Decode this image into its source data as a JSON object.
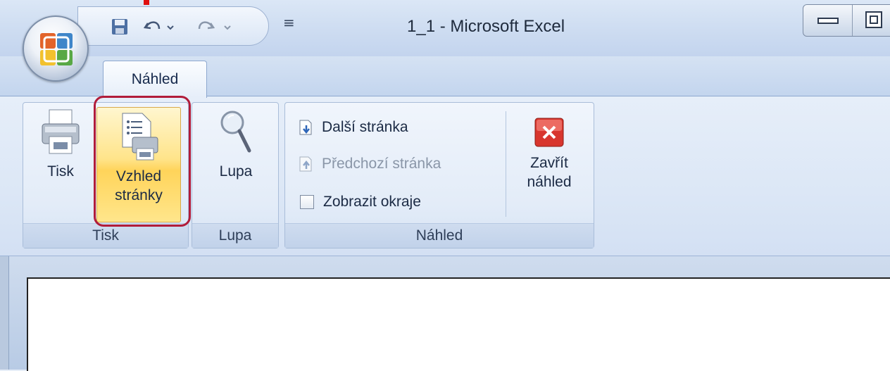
{
  "window": {
    "title": "1_1 - Microsoft Excel"
  },
  "quick_access": {
    "save_icon": "save-icon",
    "undo_icon": "undo-icon",
    "redo_icon": "redo-icon",
    "customize_glyph": "≡"
  },
  "tabs": [
    {
      "label": "Náhled"
    }
  ],
  "ribbon": {
    "groups": [
      {
        "label": "Tisk",
        "buttons": [
          {
            "label": "Tisk"
          },
          {
            "label_line1": "Vzhled",
            "label_line2": "stránky"
          }
        ]
      },
      {
        "label": "Lupa",
        "buttons": [
          {
            "label": "Lupa"
          }
        ]
      },
      {
        "label": "Náhled",
        "small_buttons": [
          {
            "label": "Další stránka"
          },
          {
            "label": "Předchozí stránka"
          },
          {
            "label": "Zobrazit okraje"
          }
        ],
        "close_button": {
          "label_line1": "Zavřít",
          "label_line2": "náhled"
        }
      }
    ]
  },
  "colors": {
    "highlight": "#ffd45a",
    "annotation_red": "#b11c3a",
    "accent_blue": "#8da8cf"
  }
}
